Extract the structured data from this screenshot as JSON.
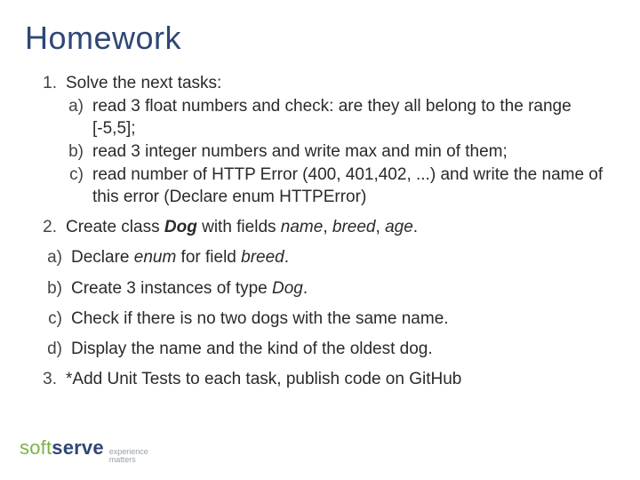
{
  "title": "Homework",
  "items": [
    {
      "num": "1.",
      "text": "Solve the next tasks:",
      "subs": [
        {
          "mk": "a)",
          "text": "read 3 float numbers and check: are they all belong to the range [-5,5];"
        },
        {
          "mk": "b)",
          "text": "read 3 integer numbers and write max and min of them;"
        },
        {
          "mk": "c)",
          "text": "read number of HTTP Error (400, 401,402, ...) and write the name of this error (Declare enum HTTPError)"
        }
      ]
    },
    {
      "num": "2.",
      "text_pre": "Create class ",
      "text_bold": "Dog",
      "text_mid": " with fields ",
      "f1": "name",
      "sep1": ", ",
      "f2": "breed",
      "sep2": ", ",
      "f3": "age",
      "text_post": ".",
      "subs2": [
        {
          "mk": "a)",
          "pre": "Declare ",
          "it": "enum",
          "post": " for field ",
          "it2": "breed",
          "tail": "."
        },
        {
          "mk": "b)",
          "pre": "Create 3 instances of type ",
          "it": "Dog",
          "post": "."
        },
        {
          "mk": "c)",
          "pre": "Check if there is no two dogs with the same name."
        },
        {
          "mk": "d)",
          "pre": "Display the name and the kind of the oldest dog."
        }
      ]
    },
    {
      "num": "3.",
      "text": "*Add Unit Tests to each task, publish code on GitHub"
    }
  ],
  "logo": {
    "soft": "soft",
    "serve": "serve",
    "tag1": "experience",
    "tag2": "matters"
  }
}
